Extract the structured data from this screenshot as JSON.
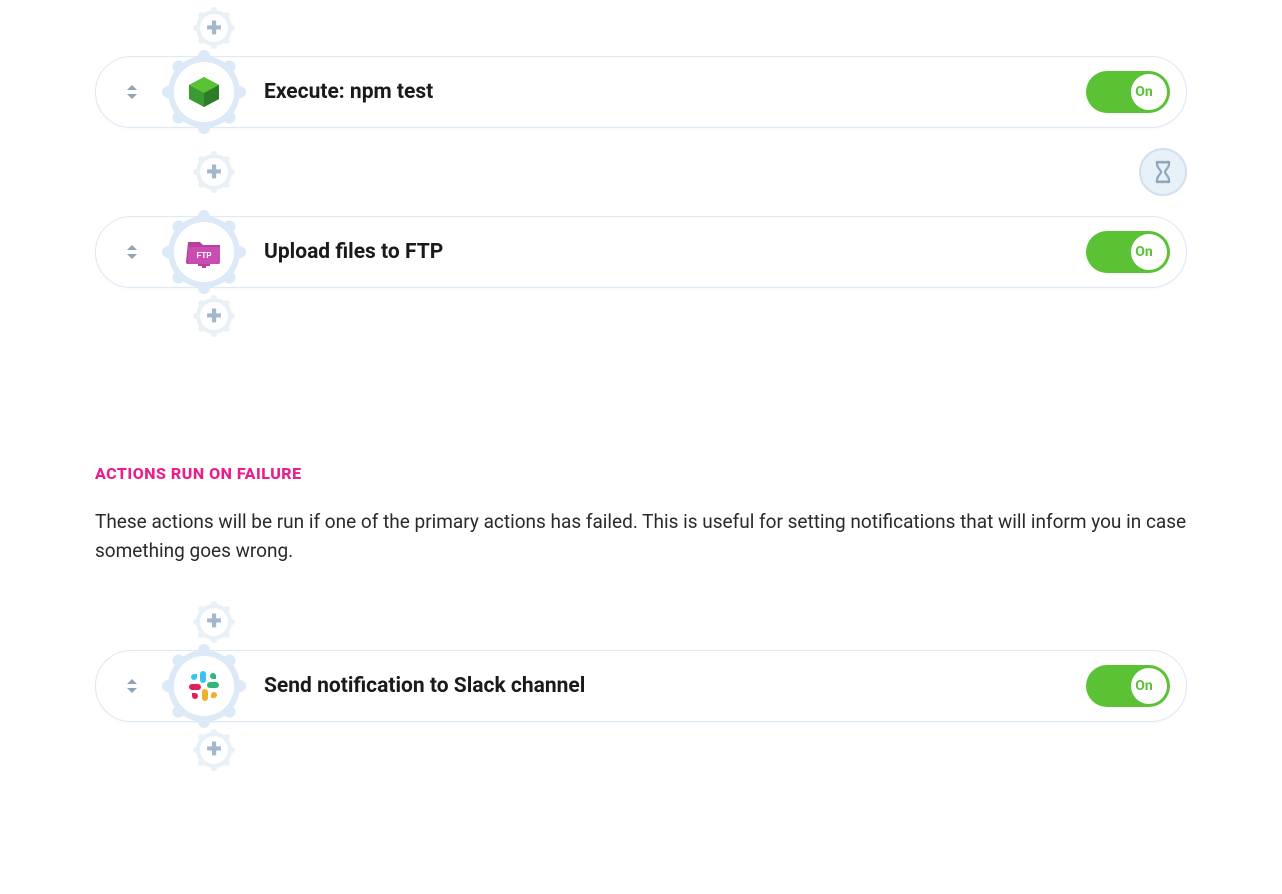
{
  "primary_actions": [
    {
      "title": "Execute: npm test",
      "toggle": "On",
      "icon": "npm"
    },
    {
      "title": "Upload files to FTP",
      "toggle": "On",
      "icon": "ftp"
    }
  ],
  "failure_section": {
    "heading": "ACTIONS RUN ON FAILURE",
    "description": "These actions will be run if one of the primary actions has failed. This is useful for setting notifications that will inform you in case something goes wrong."
  },
  "failure_actions": [
    {
      "title": "Send notification to Slack channel",
      "toggle": "On",
      "icon": "slack"
    }
  ]
}
